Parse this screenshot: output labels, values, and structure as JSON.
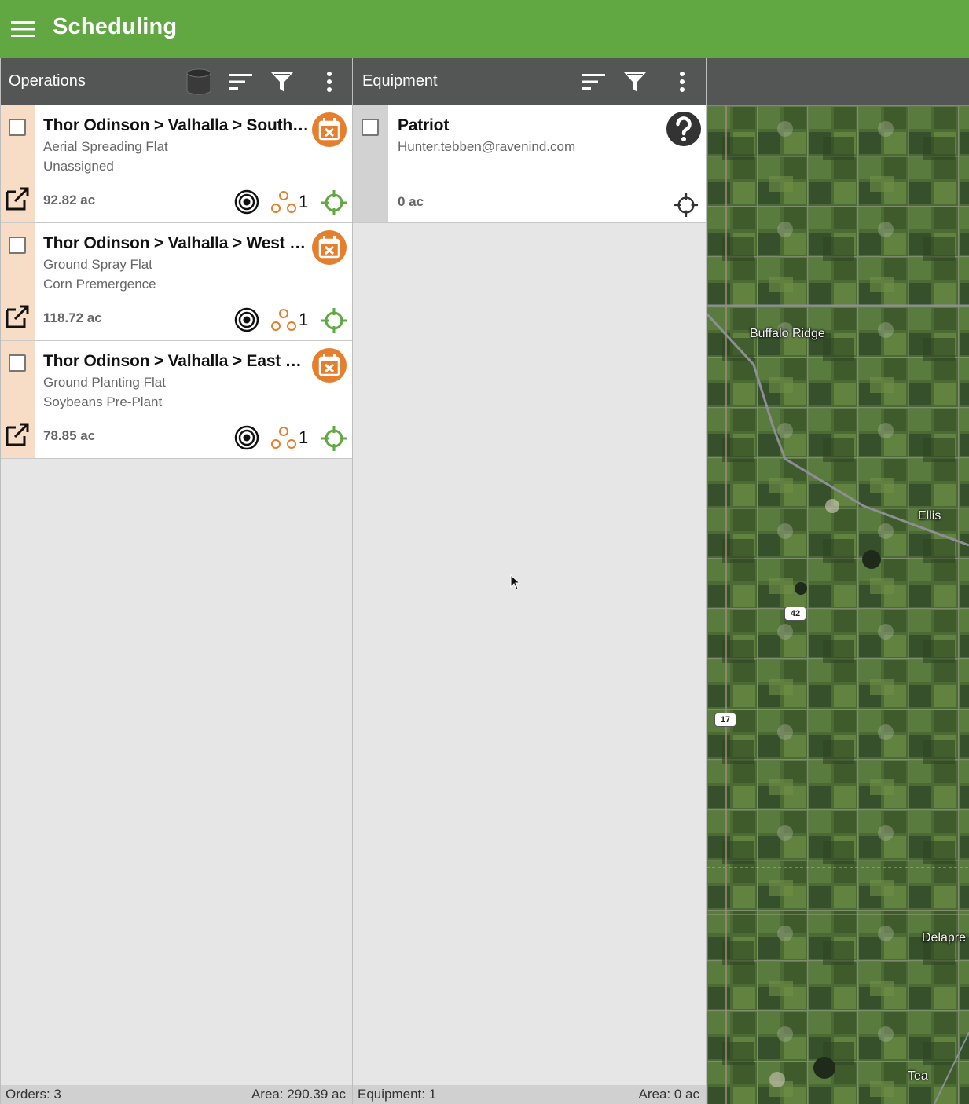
{
  "app": {
    "title": "Scheduling",
    "accent_color": "#62a842",
    "header_color": "#545656",
    "badge_color": "#e57f2d"
  },
  "operations": {
    "title": "Operations",
    "header_icons": [
      "database-icon",
      "sort-icon",
      "filter-icon",
      "more-vert-icon"
    ],
    "items": [
      {
        "title": "Thor Odinson > Valhalla > South Field",
        "type": "Aerial Spreading Flat",
        "detail": "Unassigned",
        "area": "92.82 ac",
        "people_count": "1"
      },
      {
        "title": "Thor Odinson > Valhalla > West Field",
        "type": "Ground Spray Flat",
        "detail": "Corn Premergence",
        "area": "118.72 ac",
        "people_count": "1"
      },
      {
        "title": "Thor Odinson > Valhalla > East Field",
        "type": "Ground Planting Flat",
        "detail": "Soybeans Pre-Plant",
        "area": "78.85 ac",
        "people_count": "1"
      }
    ],
    "footer": {
      "count": "Orders: 3",
      "area": "Area: 290.39 ac"
    }
  },
  "equipment": {
    "title": "Equipment",
    "header_icons": [
      "sort-icon",
      "filter-icon",
      "more-vert-icon"
    ],
    "items": [
      {
        "name": "Patriot",
        "user": "Hunter.tebben@ravenind.com",
        "area": "0 ac",
        "status_icon": "help-icon"
      }
    ],
    "footer": {
      "count": "Equipment: 1",
      "area": "Area: 0 ac"
    }
  },
  "map": {
    "labels": [
      "Buffalo Ridge",
      "Ellis",
      "Delapre",
      "Tea"
    ],
    "route_shields": [
      "42",
      "17"
    ]
  }
}
